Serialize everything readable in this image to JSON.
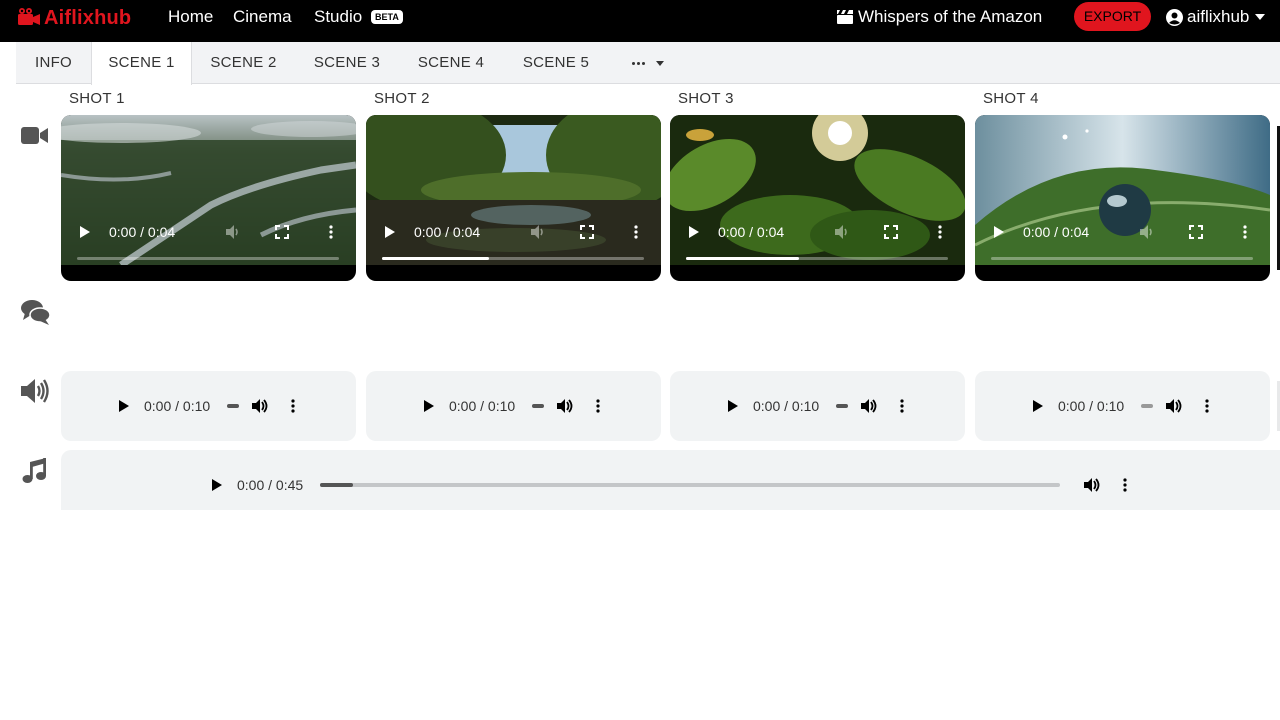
{
  "brand": {
    "name": "Aiflixhub",
    "color": "#e0151e"
  },
  "nav": {
    "home": "Home",
    "cinema": "Cinema",
    "studio": "Studio",
    "studio_badge": "BETA",
    "project_title": "Whispers of the Amazon",
    "export": "EXPORT",
    "username": "aiflixhub"
  },
  "tabs": [
    "INFO",
    "SCENE 1",
    "SCENE 2",
    "SCENE 3",
    "SCENE 4",
    "SCENE 5"
  ],
  "active_tab": "SCENE 1",
  "shots": [
    {
      "label": "SHOT 1",
      "video_time": "0:00 / 0:04",
      "video_progress": 0.0,
      "audio_time": "0:00 / 0:10",
      "scene": "aerial-river"
    },
    {
      "label": "SHOT 2",
      "video_time": "0:00 / 0:04",
      "video_progress": 0.41,
      "audio_time": "0:00 / 0:10",
      "scene": "jungle-lake"
    },
    {
      "label": "SHOT 3",
      "video_time": "0:00 / 0:04",
      "video_progress": 0.43,
      "audio_time": "0:00 / 0:10",
      "scene": "canopy-sun"
    },
    {
      "label": "SHOT 4",
      "video_time": "0:00 / 0:04",
      "video_progress": 0.0,
      "audio_time": "0:00 / 0:10",
      "scene": "leaf-droplet"
    }
  ],
  "music": {
    "time": "0:00 / 0:45",
    "progress": 0.045
  },
  "icons": {
    "video_row": "video-camera-icon",
    "dialogue_row": "chat-bubbles-icon",
    "voice_row": "speaker-icon",
    "music_row": "music-note-icon"
  }
}
